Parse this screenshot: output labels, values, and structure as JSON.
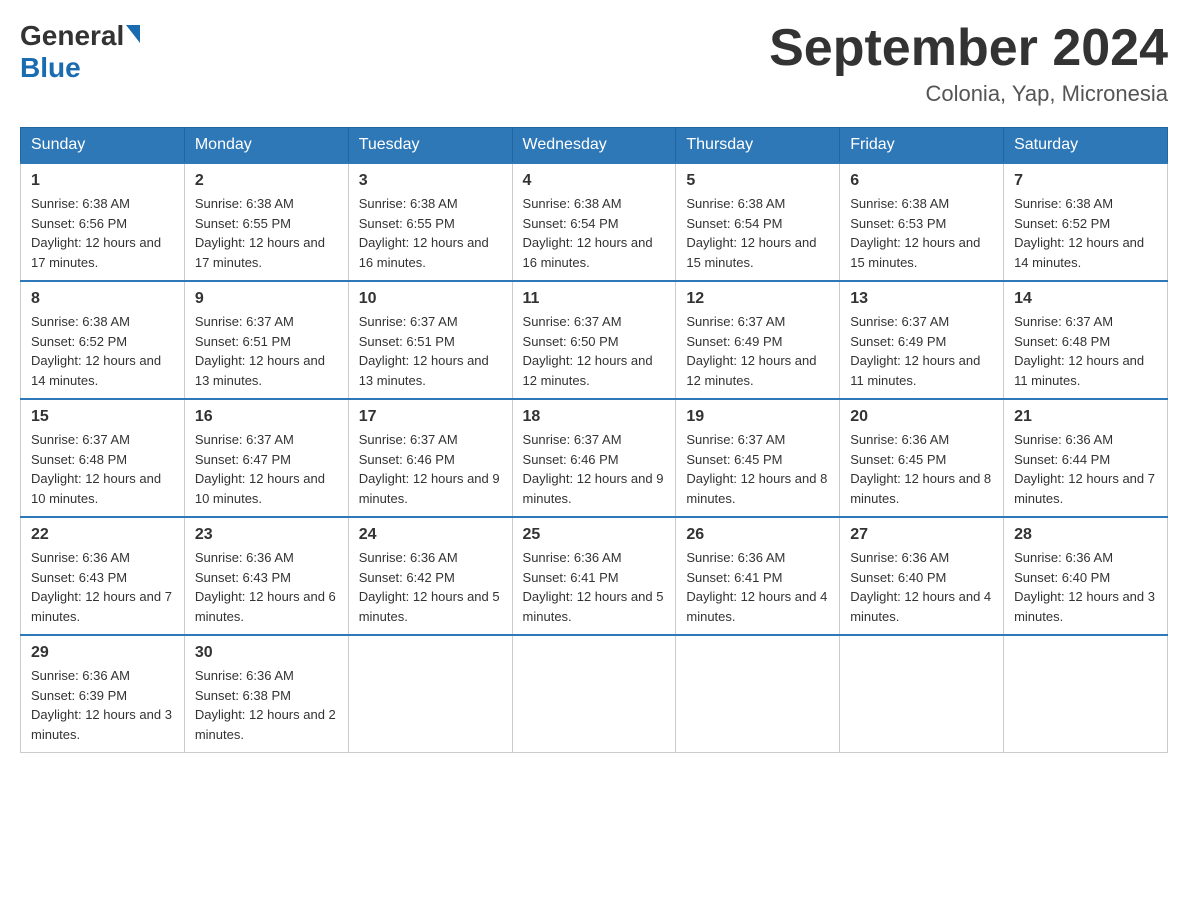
{
  "header": {
    "logo_general": "General",
    "logo_blue": "Blue",
    "month_title": "September 2024",
    "location": "Colonia, Yap, Micronesia"
  },
  "weekdays": [
    "Sunday",
    "Monday",
    "Tuesday",
    "Wednesday",
    "Thursday",
    "Friday",
    "Saturday"
  ],
  "weeks": [
    [
      {
        "day": "1",
        "sunrise": "6:38 AM",
        "sunset": "6:56 PM",
        "daylight": "12 hours and 17 minutes."
      },
      {
        "day": "2",
        "sunrise": "6:38 AM",
        "sunset": "6:55 PM",
        "daylight": "12 hours and 17 minutes."
      },
      {
        "day": "3",
        "sunrise": "6:38 AM",
        "sunset": "6:55 PM",
        "daylight": "12 hours and 16 minutes."
      },
      {
        "day": "4",
        "sunrise": "6:38 AM",
        "sunset": "6:54 PM",
        "daylight": "12 hours and 16 minutes."
      },
      {
        "day": "5",
        "sunrise": "6:38 AM",
        "sunset": "6:54 PM",
        "daylight": "12 hours and 15 minutes."
      },
      {
        "day": "6",
        "sunrise": "6:38 AM",
        "sunset": "6:53 PM",
        "daylight": "12 hours and 15 minutes."
      },
      {
        "day": "7",
        "sunrise": "6:38 AM",
        "sunset": "6:52 PM",
        "daylight": "12 hours and 14 minutes."
      }
    ],
    [
      {
        "day": "8",
        "sunrise": "6:38 AM",
        "sunset": "6:52 PM",
        "daylight": "12 hours and 14 minutes."
      },
      {
        "day": "9",
        "sunrise": "6:37 AM",
        "sunset": "6:51 PM",
        "daylight": "12 hours and 13 minutes."
      },
      {
        "day": "10",
        "sunrise": "6:37 AM",
        "sunset": "6:51 PM",
        "daylight": "12 hours and 13 minutes."
      },
      {
        "day": "11",
        "sunrise": "6:37 AM",
        "sunset": "6:50 PM",
        "daylight": "12 hours and 12 minutes."
      },
      {
        "day": "12",
        "sunrise": "6:37 AM",
        "sunset": "6:49 PM",
        "daylight": "12 hours and 12 minutes."
      },
      {
        "day": "13",
        "sunrise": "6:37 AM",
        "sunset": "6:49 PM",
        "daylight": "12 hours and 11 minutes."
      },
      {
        "day": "14",
        "sunrise": "6:37 AM",
        "sunset": "6:48 PM",
        "daylight": "12 hours and 11 minutes."
      }
    ],
    [
      {
        "day": "15",
        "sunrise": "6:37 AM",
        "sunset": "6:48 PM",
        "daylight": "12 hours and 10 minutes."
      },
      {
        "day": "16",
        "sunrise": "6:37 AM",
        "sunset": "6:47 PM",
        "daylight": "12 hours and 10 minutes."
      },
      {
        "day": "17",
        "sunrise": "6:37 AM",
        "sunset": "6:46 PM",
        "daylight": "12 hours and 9 minutes."
      },
      {
        "day": "18",
        "sunrise": "6:37 AM",
        "sunset": "6:46 PM",
        "daylight": "12 hours and 9 minutes."
      },
      {
        "day": "19",
        "sunrise": "6:37 AM",
        "sunset": "6:45 PM",
        "daylight": "12 hours and 8 minutes."
      },
      {
        "day": "20",
        "sunrise": "6:36 AM",
        "sunset": "6:45 PM",
        "daylight": "12 hours and 8 minutes."
      },
      {
        "day": "21",
        "sunrise": "6:36 AM",
        "sunset": "6:44 PM",
        "daylight": "12 hours and 7 minutes."
      }
    ],
    [
      {
        "day": "22",
        "sunrise": "6:36 AM",
        "sunset": "6:43 PM",
        "daylight": "12 hours and 7 minutes."
      },
      {
        "day": "23",
        "sunrise": "6:36 AM",
        "sunset": "6:43 PM",
        "daylight": "12 hours and 6 minutes."
      },
      {
        "day": "24",
        "sunrise": "6:36 AM",
        "sunset": "6:42 PM",
        "daylight": "12 hours and 5 minutes."
      },
      {
        "day": "25",
        "sunrise": "6:36 AM",
        "sunset": "6:41 PM",
        "daylight": "12 hours and 5 minutes."
      },
      {
        "day": "26",
        "sunrise": "6:36 AM",
        "sunset": "6:41 PM",
        "daylight": "12 hours and 4 minutes."
      },
      {
        "day": "27",
        "sunrise": "6:36 AM",
        "sunset": "6:40 PM",
        "daylight": "12 hours and 4 minutes."
      },
      {
        "day": "28",
        "sunrise": "6:36 AM",
        "sunset": "6:40 PM",
        "daylight": "12 hours and 3 minutes."
      }
    ],
    [
      {
        "day": "29",
        "sunrise": "6:36 AM",
        "sunset": "6:39 PM",
        "daylight": "12 hours and 3 minutes."
      },
      {
        "day": "30",
        "sunrise": "6:36 AM",
        "sunset": "6:38 PM",
        "daylight": "12 hours and 2 minutes."
      },
      null,
      null,
      null,
      null,
      null
    ]
  ]
}
